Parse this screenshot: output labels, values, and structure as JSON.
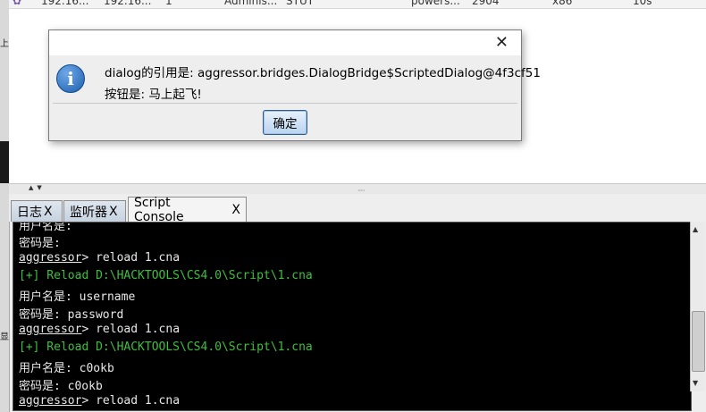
{
  "session_row": {
    "cells": [
      "192.16...",
      "192.16...",
      "1",
      "Adminis...",
      "STUT",
      "powers...",
      "2904",
      "x86",
      "10s"
    ]
  },
  "dialog": {
    "message_line1": "dialog的引用是: aggressor.bridges.DialogBridge$ScriptedDialog@4f3cf51",
    "message_line2": "按钮是: 马上起飞!",
    "ok_label": "确定"
  },
  "tabs": [
    {
      "label": "日志",
      "close": "X"
    },
    {
      "label": "监听器",
      "close": "X"
    },
    {
      "label": "Script Console",
      "close": "X"
    }
  ],
  "console": {
    "lines": [
      {
        "prompt": "",
        "text": "用户名是:"
      },
      {
        "prompt": "",
        "text": "密码是:"
      },
      {
        "prompt": "aggressor",
        "text": "> reload 1.cna"
      },
      {
        "prompt": "",
        "text": "[+] Reload D:\\HACKTOOLS\\CS4.0\\Script\\1.cna"
      },
      {
        "prompt": "",
        "text": "用户名是: username"
      },
      {
        "prompt": "",
        "text": "密码是: password"
      },
      {
        "prompt": "aggressor",
        "text": "> reload 1.cna"
      },
      {
        "prompt": "",
        "text": "[+] Reload D:\\HACKTOOLS\\CS4.0\\Script\\1.cna"
      },
      {
        "prompt": "",
        "text": "用户名是: c0okb"
      },
      {
        "prompt": "",
        "text": "密码是: c0okb"
      },
      {
        "prompt": "aggressor",
        "text": "> reload 1.cna"
      }
    ]
  },
  "colors": {
    "console_bg": "#000000",
    "console_text": "#e8e8e8",
    "reload_green": "#3fbf3f",
    "tab_inactive": "#c6d2e0"
  }
}
